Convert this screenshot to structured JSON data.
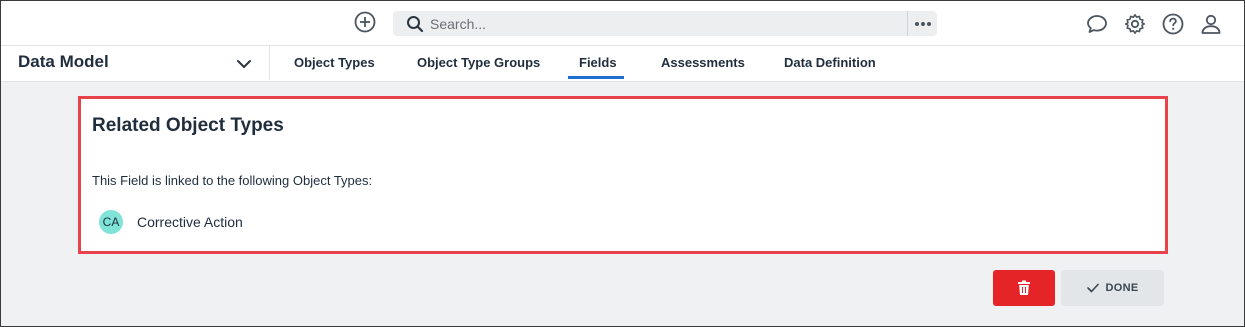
{
  "topbar": {
    "search_placeholder": "Search...",
    "icons": [
      "add-circle-icon",
      "search-icon",
      "more-horizontal-icon",
      "chat-icon",
      "gear-icon",
      "help-icon",
      "user-icon"
    ]
  },
  "subnav": {
    "title": "Data Model",
    "tabs": [
      {
        "label": "Object Types",
        "active": false
      },
      {
        "label": "Object Type Groups",
        "active": false
      },
      {
        "label": "Fields",
        "active": true
      },
      {
        "label": "Assessments",
        "active": false
      },
      {
        "label": "Data Definition",
        "active": false
      }
    ]
  },
  "panel": {
    "heading": "Related Object Types",
    "description": "This Field is linked to the following Object Types:",
    "items": [
      {
        "initials": "CA",
        "label": "Corrective Action"
      }
    ]
  },
  "actions": {
    "done_label": "DONE"
  },
  "colors": {
    "accent": "#1f6fd1",
    "highlight_border": "#e8434c",
    "delete": "#e42426",
    "avatar": "#7fe3d8"
  }
}
